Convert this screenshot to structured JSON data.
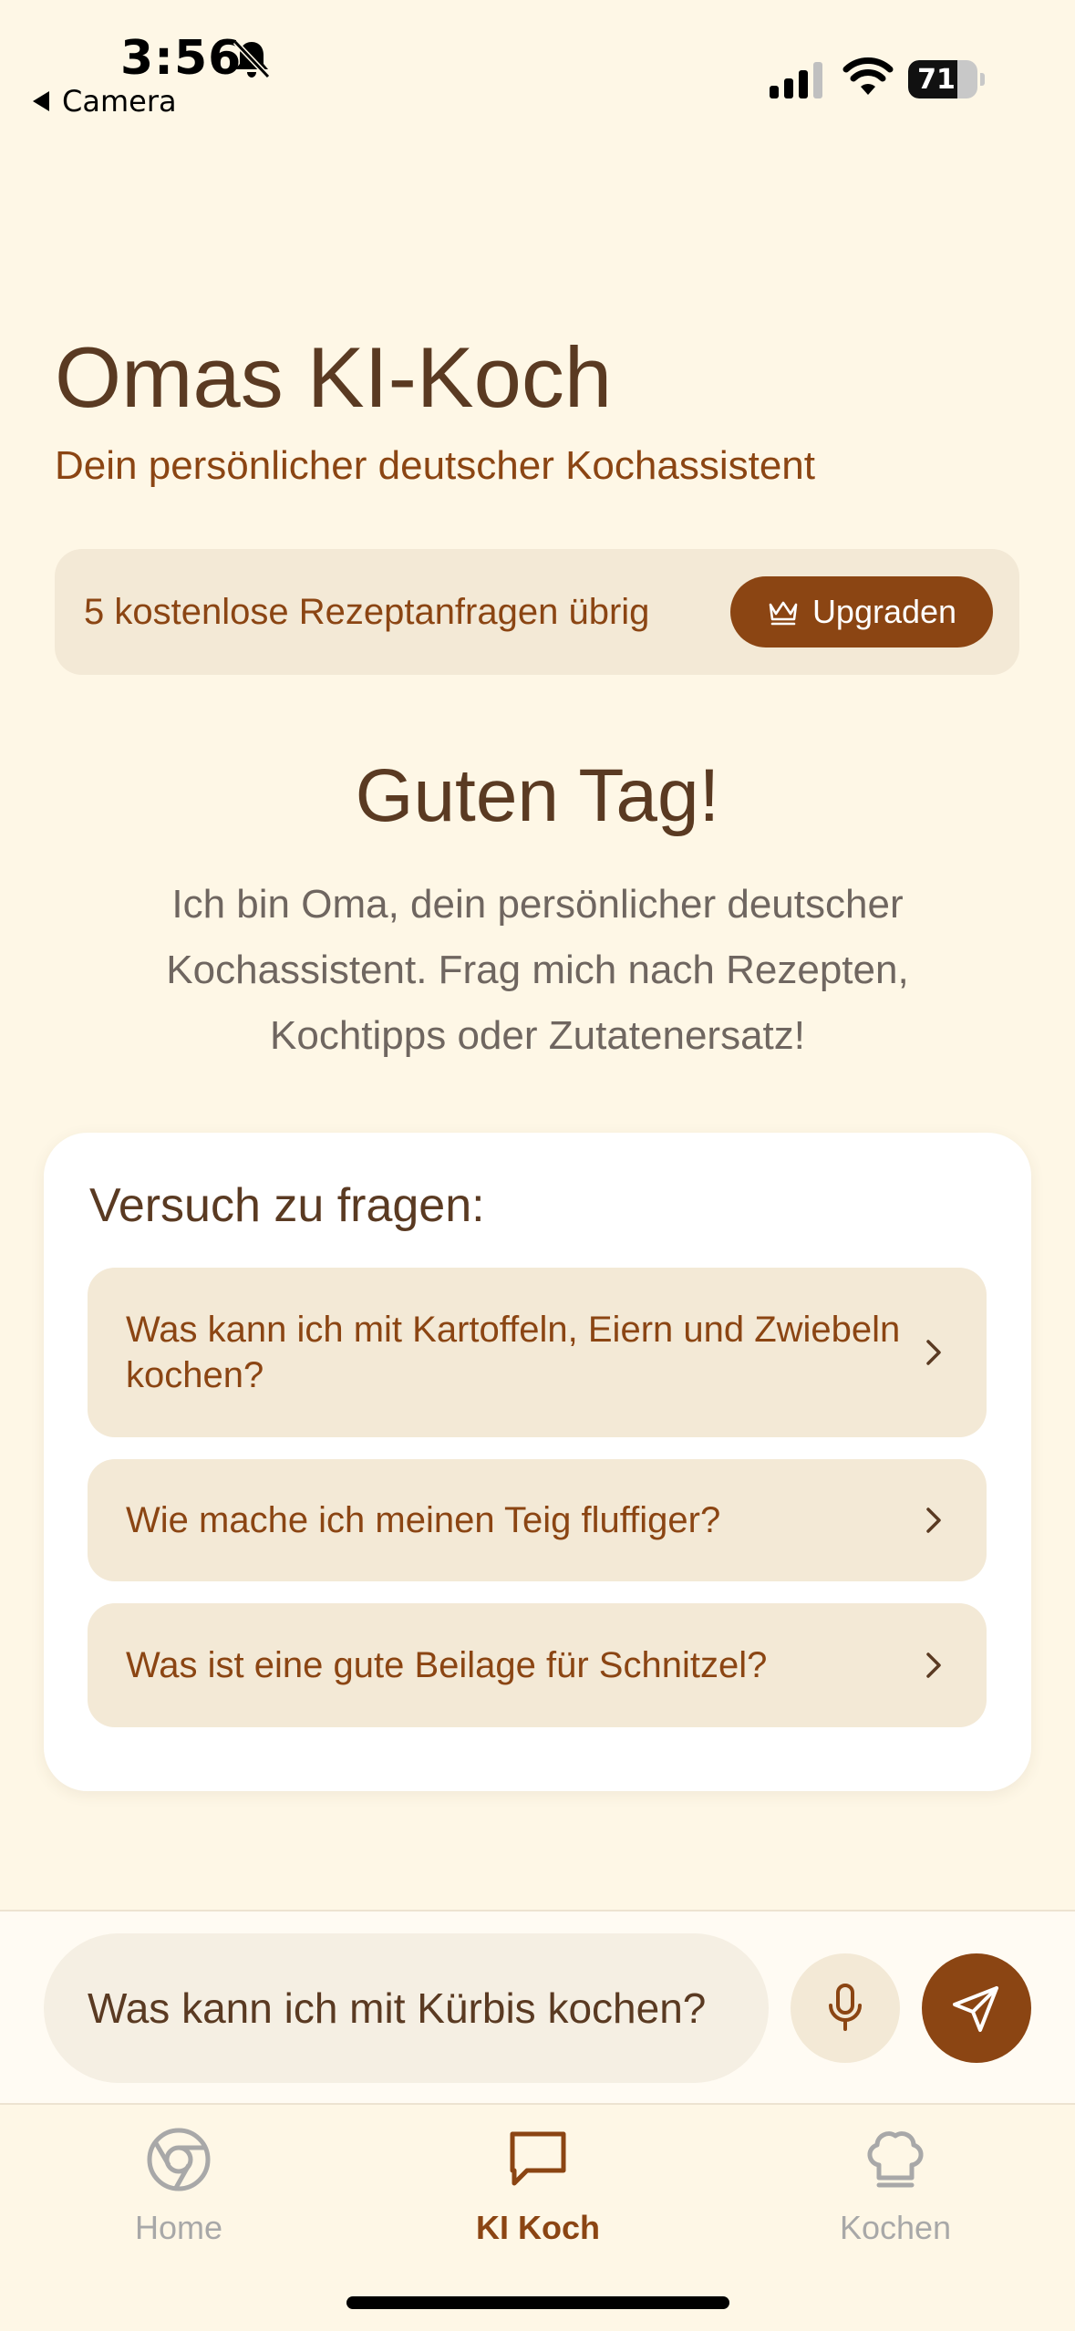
{
  "status_bar": {
    "time": "3:56",
    "back_label": "Camera",
    "battery": "71",
    "battery_level_percent": 71
  },
  "header": {
    "title": "Omas KI-Koch",
    "subtitle": "Dein persönlicher deutscher Kochassistent"
  },
  "quota": {
    "text": "5 kostenlose Rezeptanfragen übrig",
    "upgrade_label": "Upgraden"
  },
  "greeting": {
    "title": "Guten Tag!",
    "body": "Ich bin Oma, dein persönlicher deutscher Kochassistent. Frag mich nach Rezepten, Kochtipps oder Zutatenersatz!"
  },
  "suggestions": {
    "heading": "Versuch zu fragen:",
    "items": [
      "Was kann ich mit Kartoffeln, Eiern und Zwiebeln kochen?",
      "Wie mache ich meinen Teig fluffiger?",
      "Was ist eine gute Beilage für Schnitzel?"
    ]
  },
  "input": {
    "value": "Was kann ich mit Kürbis kochen?"
  },
  "tabs": [
    {
      "label": "Home",
      "icon": "chrome-icon",
      "active": false
    },
    {
      "label": "KI Koch",
      "icon": "chat-bubble-icon",
      "active": true
    },
    {
      "label": "Kochen",
      "icon": "chef-hat-icon",
      "active": false
    }
  ],
  "colors": {
    "background": "#FEF7E6",
    "accent": "#8B4513",
    "chip": "#F3E9D6",
    "title_text": "#5A3A22"
  }
}
